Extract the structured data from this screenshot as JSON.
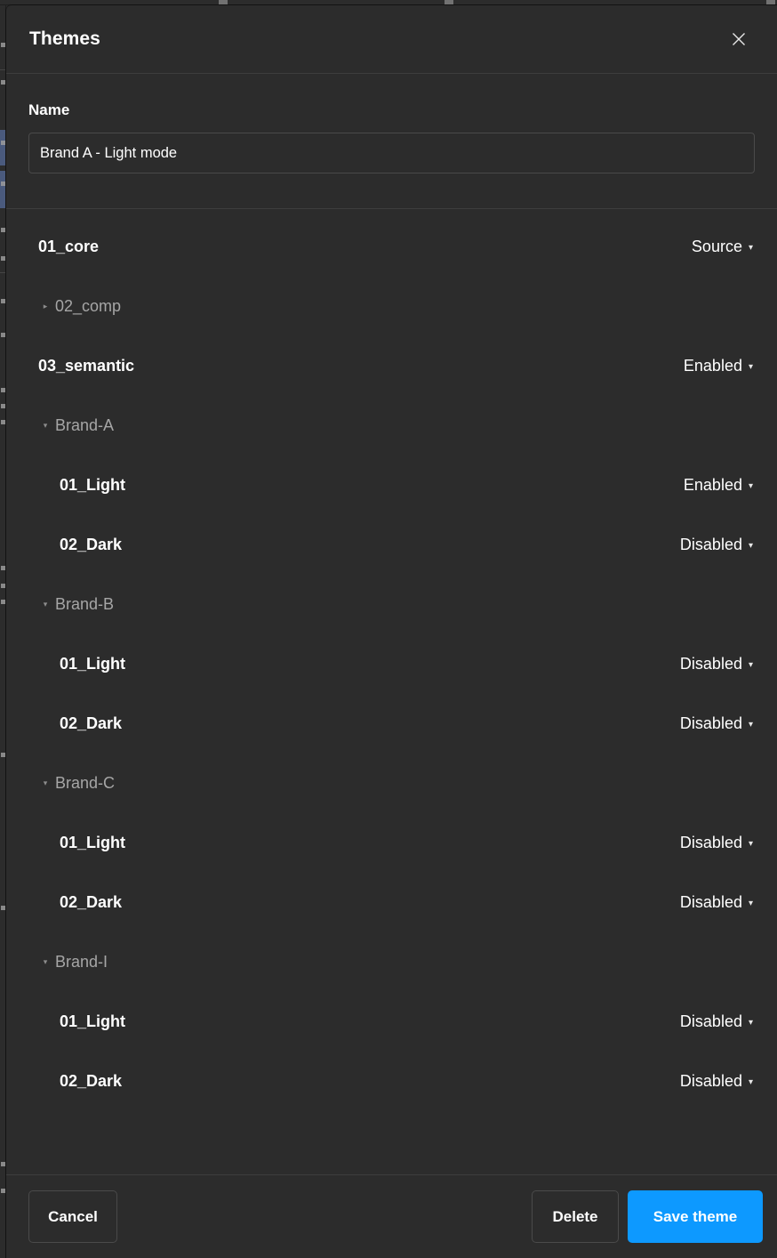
{
  "colors": {
    "modal_bg": "#2c2c2c",
    "divider": "#3d3d3d",
    "text_primary": "#ffffff",
    "text_muted": "#a6a6a6",
    "input_border": "#4a4a4a",
    "accent_blue": "#0d99ff",
    "bg_selected_row": "#4a5a7d"
  },
  "header": {
    "title": "Themes",
    "close_icon": "close-icon"
  },
  "name_section": {
    "label": "Name",
    "value": "Brand A - Light mode",
    "placeholder": "Theme name"
  },
  "collections": [
    {
      "label": "01_core",
      "kind": "item",
      "level": 0,
      "disclosure": "none",
      "status": "Source",
      "caret": "▾"
    },
    {
      "label": "02_comp",
      "kind": "group",
      "level": 0,
      "disclosure": "▸",
      "status": "",
      "caret": ""
    },
    {
      "label": "03_semantic",
      "kind": "item",
      "level": 0,
      "disclosure": "none",
      "status": "Enabled",
      "caret": "▾"
    },
    {
      "label": "Brand-A",
      "kind": "group",
      "level": 0,
      "disclosure": "▾",
      "status": "",
      "caret": ""
    },
    {
      "label": "01_Light",
      "kind": "item",
      "level": 1,
      "disclosure": "none",
      "status": "Enabled",
      "caret": "▾"
    },
    {
      "label": "02_Dark",
      "kind": "item",
      "level": 1,
      "disclosure": "none",
      "status": "Disabled",
      "caret": "▾"
    },
    {
      "label": "Brand-B",
      "kind": "group",
      "level": 0,
      "disclosure": "▾",
      "status": "",
      "caret": ""
    },
    {
      "label": "01_Light",
      "kind": "item",
      "level": 1,
      "disclosure": "none",
      "status": "Disabled",
      "caret": "▾"
    },
    {
      "label": "02_Dark",
      "kind": "item",
      "level": 1,
      "disclosure": "none",
      "status": "Disabled",
      "caret": "▾"
    },
    {
      "label": "Brand-C",
      "kind": "group",
      "level": 0,
      "disclosure": "▾",
      "status": "",
      "caret": ""
    },
    {
      "label": "01_Light",
      "kind": "item",
      "level": 1,
      "disclosure": "none",
      "status": "Disabled",
      "caret": "▾"
    },
    {
      "label": "02_Dark",
      "kind": "item",
      "level": 1,
      "disclosure": "none",
      "status": "Disabled",
      "caret": "▾"
    },
    {
      "label": "Brand-I",
      "kind": "group",
      "level": 0,
      "disclosure": "▾",
      "status": "",
      "caret": ""
    },
    {
      "label": "01_Light",
      "kind": "item",
      "level": 1,
      "disclosure": "none",
      "status": "Disabled",
      "caret": "▾"
    },
    {
      "label": "02_Dark",
      "kind": "item",
      "level": 1,
      "disclosure": "none",
      "status": "Disabled",
      "caret": "▾"
    }
  ],
  "footer": {
    "cancel_label": "Cancel",
    "delete_label": "Delete",
    "save_label": "Save theme"
  }
}
